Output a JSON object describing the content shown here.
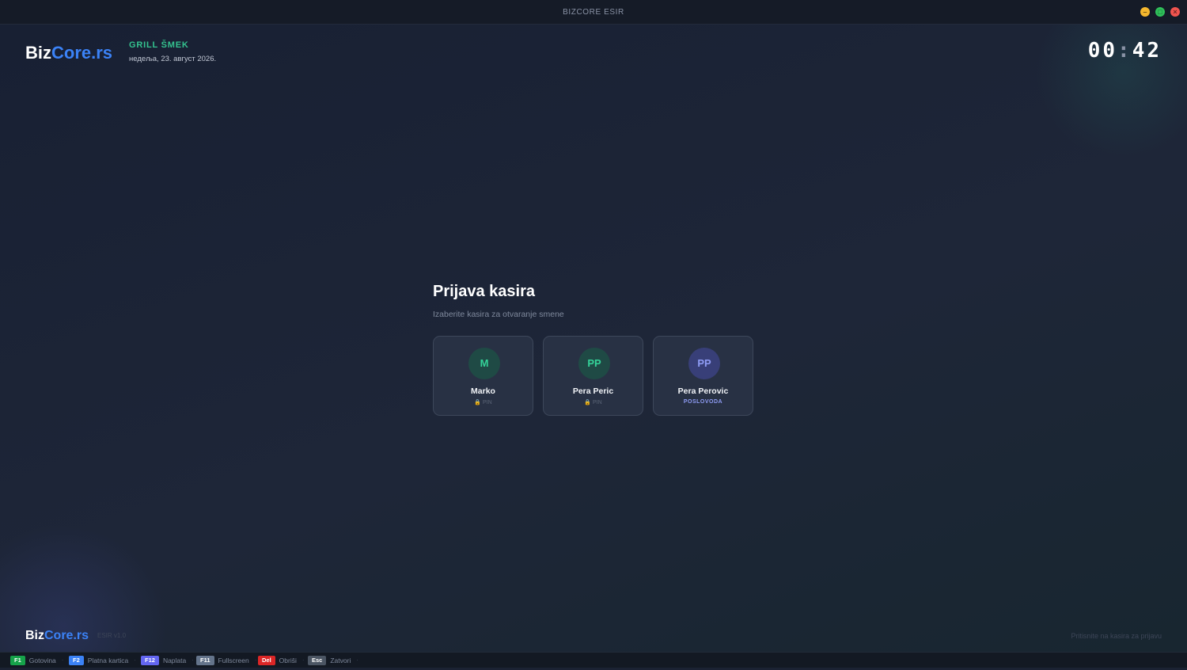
{
  "window": {
    "title": "BIZCORE ESIR",
    "controls": [
      "minimize",
      "maximize",
      "close"
    ]
  },
  "header": {
    "logo_part1": "Biz",
    "logo_part2": "Core.rs",
    "store_name": "GRILL ŠMEK",
    "date": "недеља, 23. август 2026.",
    "clock_hours": "00",
    "clock_sep": ":",
    "clock_minutes": "42"
  },
  "login": {
    "title": "Prijava kasira",
    "subtitle": "Izaberite kasira za otvaranje smene",
    "cashiers": [
      {
        "initials": "M",
        "name": "Marko",
        "sub": "🔒 PIN",
        "color": "green"
      },
      {
        "initials": "PP",
        "name": "Pera Peric",
        "sub": "🔒 PIN",
        "color": "green"
      },
      {
        "initials": "PP",
        "name": "Pera Perovic",
        "sub": "POSLOVODA",
        "color": "purple"
      }
    ]
  },
  "footer": {
    "logo_part1": "Biz",
    "logo_part2": "Core.rs",
    "version": "ESIR v1.0",
    "hint": "Pritisnite na kasira za prijavu"
  },
  "shortcuts": [
    {
      "key": "F1",
      "label": "Gotovina",
      "color": "#16a34a"
    },
    {
      "key": "F2",
      "label": "Platna kartica",
      "color": "#3b82f6"
    },
    {
      "key": "F12",
      "label": "Naplata",
      "color": "#6366f1"
    },
    {
      "key": "F11",
      "label": "Fullscreen",
      "color": "#64748b"
    },
    {
      "key": "Del",
      "label": "Obriši",
      "color": "#dc2626"
    },
    {
      "key": "Esc",
      "label": "Zatvori",
      "color": "#4b5563"
    }
  ],
  "colors": {
    "accent_blue": "#3b82f6",
    "accent_green": "#34c38f",
    "accent_purple": "#8f9cf5"
  }
}
